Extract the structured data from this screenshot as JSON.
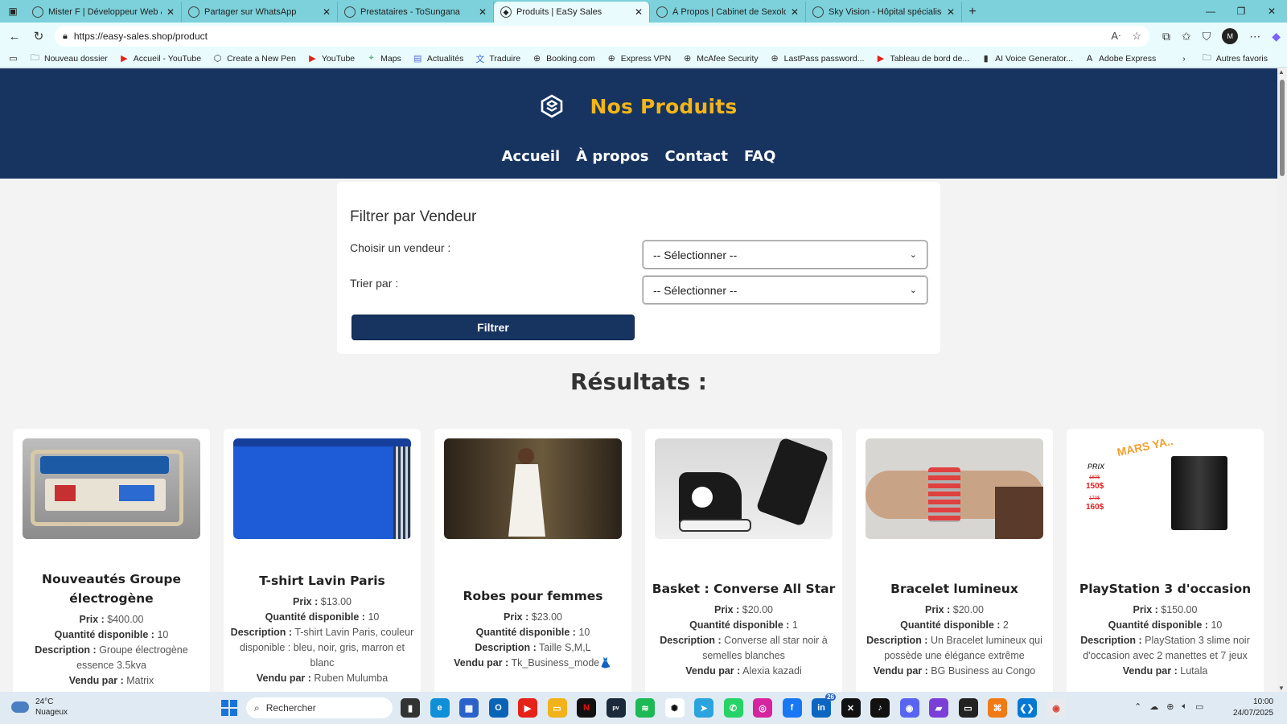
{
  "browser": {
    "tabs": [
      {
        "title": "Mister F | Développeur Web & Fo",
        "active": false
      },
      {
        "title": "Partager sur WhatsApp",
        "active": false
      },
      {
        "title": "Prestataires - ToSungana",
        "active": false
      },
      {
        "title": "Produits | EaSy Sales",
        "active": true
      },
      {
        "title": "À Propos | Cabinet de Sexologie",
        "active": false
      },
      {
        "title": "Sky Vision - Hôpital spécialisé en",
        "active": false
      }
    ],
    "url": "https://easy-sales.shop/product",
    "bookmarks": [
      {
        "label": "Nouveau dossier",
        "icon": "folder-icon"
      },
      {
        "label": "Accueil - YouTube",
        "icon": "youtube-icon"
      },
      {
        "label": "Create a New Pen",
        "icon": "codepen-icon"
      },
      {
        "label": "YouTube",
        "icon": "youtube-icon"
      },
      {
        "label": "Maps",
        "icon": "maps-icon"
      },
      {
        "label": "Actualités",
        "icon": "news-icon"
      },
      {
        "label": "Traduire",
        "icon": "translate-icon"
      },
      {
        "label": "Booking.com",
        "icon": "globe-icon"
      },
      {
        "label": "Express VPN",
        "icon": "globe-icon"
      },
      {
        "label": "McAfee Security",
        "icon": "globe-icon"
      },
      {
        "label": "LastPass password...",
        "icon": "globe-icon"
      },
      {
        "label": "Tableau de bord de...",
        "icon": "youtube-icon"
      },
      {
        "label": "AI Voice Generator...",
        "icon": "doc-icon"
      },
      {
        "label": "Adobe Express",
        "icon": "adobe-icon"
      }
    ],
    "other_favorites": "Autres favoris"
  },
  "site": {
    "title": "Nos Produits",
    "nav": [
      "Accueil",
      "À propos",
      "Contact",
      "FAQ"
    ]
  },
  "filter": {
    "heading": "Filtrer par Vendeur",
    "vendor_label": "Choisir un vendeur :",
    "vendor_value": "-- Sélectionner --",
    "sort_label": "Trier par :",
    "sort_value": "-- Sélectionner --",
    "button": "Filtrer"
  },
  "results_title": "Résultats :",
  "labels": {
    "price": "Prix :",
    "qty": "Quantité disponible :",
    "desc": "Description :",
    "seller": "Vendu par :"
  },
  "products": [
    {
      "name": "Nouveautés Groupe électrogène",
      "price": "$400.00",
      "qty": "10",
      "desc": "Groupe électrogène essence 3.5kva",
      "seller": "Matrix",
      "image": "generator"
    },
    {
      "name": "T-shirt Lavin Paris",
      "price": "$13.00",
      "qty": "10",
      "desc": "T-shirt Lavin Paris, couleur disponible : bleu, noir, gris, marron et blanc",
      "seller": "Ruben Mulumba",
      "image": "tshirt"
    },
    {
      "name": "Robes pour femmes",
      "price": "$23.00",
      "qty": "10",
      "desc": "Taille S,M,L",
      "seller": "Tk_Business_mode👗",
      "image": "dress"
    },
    {
      "name": "Basket : Converse All Star",
      "price": "$20.00",
      "qty": "1",
      "desc": "Converse all star noir à semelles blanches",
      "seller": "Alexia kazadi",
      "image": "sneakers"
    },
    {
      "name": "Bracelet lumineux",
      "price": "$20.00",
      "qty": "2",
      "desc": "Un Bracelet lumineux qui possède une élégance extrême",
      "seller": "BG Business au Congo",
      "image": "bracelet"
    },
    {
      "name": "PlayStation 3 d'occasion",
      "price": "$150.00",
      "qty": "10",
      "desc": "PlayStation 3 slime noir d'occasion avec 2 manettes et 7 jeux",
      "seller": "Lutala",
      "image": "ps3"
    }
  ],
  "ps3_image_text": {
    "headline": "MARS YA..",
    "prix": "PRIX",
    "old1": "180$",
    "new1": "150$",
    "old2": "170$",
    "new2": "160$"
  },
  "taskbar": {
    "temp": "24°C",
    "weather": "Nuageux",
    "search": "Rechercher",
    "time": "10:00",
    "date": "24/07/2025",
    "linkedin_badge": "26"
  }
}
